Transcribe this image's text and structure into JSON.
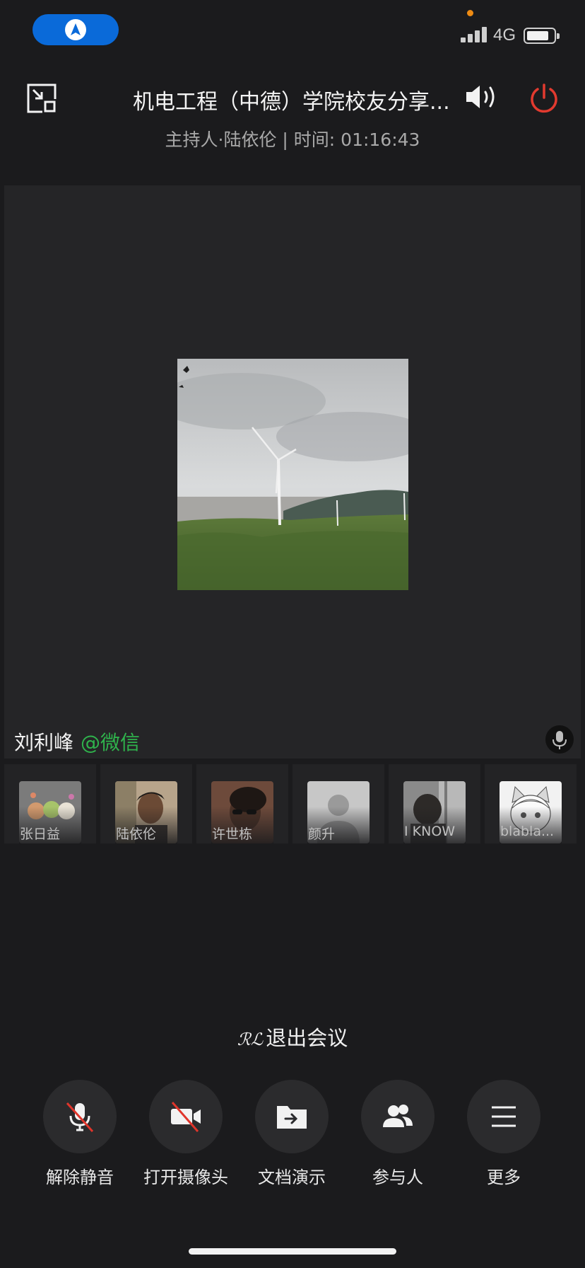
{
  "status_bar": {
    "network": "4G"
  },
  "header": {
    "title": "机电工程（中德）学院校友分享...",
    "subtitle": "主持人·陆依伦 | 时间: 01:16:43"
  },
  "stage": {
    "speaker_name": "刘利峰",
    "speaker_source": "@微信"
  },
  "participants": [
    {
      "name": "张日益"
    },
    {
      "name": "陆依伦"
    },
    {
      "name": "许世栋"
    },
    {
      "name": "颜升"
    },
    {
      "name": "I KNOW"
    },
    {
      "name": "blabla..."
    }
  ],
  "leave": {
    "prefix": "ℛℒ",
    "label": "退出会议"
  },
  "controls": {
    "unmute": "解除静音",
    "camera": "打开摄像头",
    "present": "文档演示",
    "participants": "参与人",
    "more": "更多"
  },
  "colors": {
    "background": "#1b1b1d",
    "stage": "#252527",
    "accent_blue": "#0a6ad9",
    "power_red": "#e23a2f",
    "source_green": "#2fb34c",
    "mute_slash": "#e0352b"
  },
  "icons": [
    "navigation-icon",
    "exit-fullscreen-icon",
    "speaker-icon",
    "power-icon",
    "microphone-icon",
    "camera-off-icon",
    "folder-share-icon",
    "people-icon",
    "menu-icon"
  ]
}
